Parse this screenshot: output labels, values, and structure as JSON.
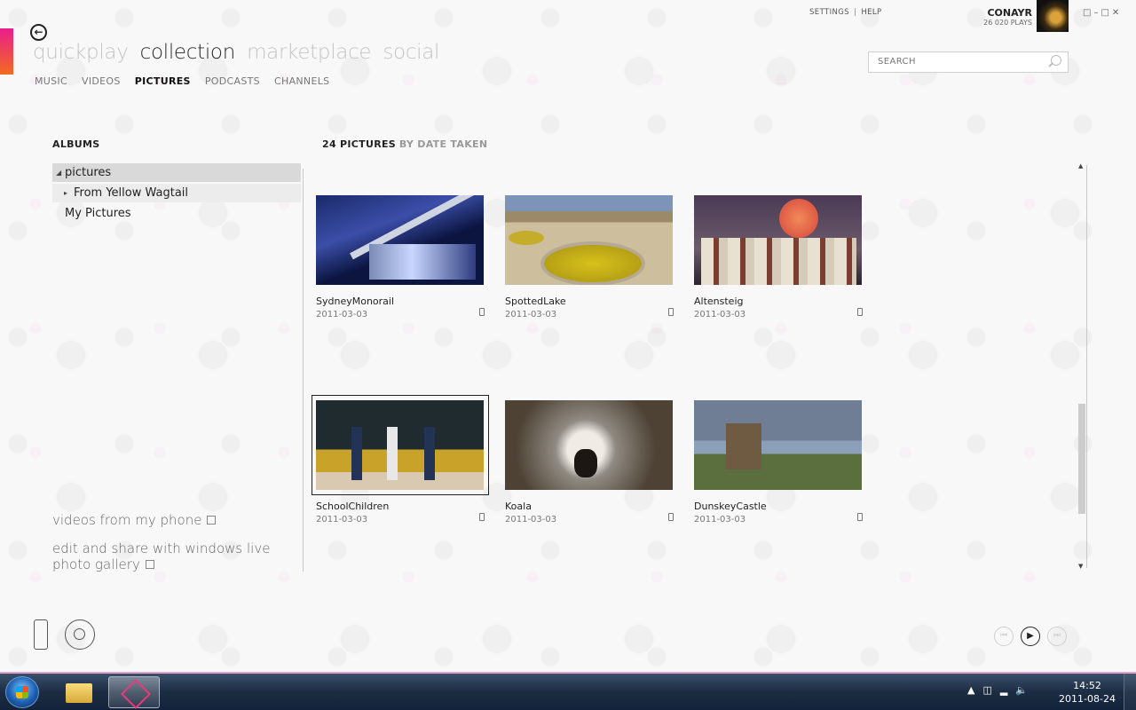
{
  "app": {
    "pivots": [
      {
        "label": "quickplay",
        "active": false
      },
      {
        "label": "collection",
        "active": true
      },
      {
        "label": "marketplace",
        "active": false
      },
      {
        "label": "social",
        "active": false
      }
    ],
    "subnav": [
      {
        "label": "MUSIC",
        "active": false
      },
      {
        "label": "VIDEOS",
        "active": false
      },
      {
        "label": "PICTURES",
        "active": true
      },
      {
        "label": "PODCASTS",
        "active": false
      },
      {
        "label": "CHANNELS",
        "active": false
      }
    ],
    "top_links": {
      "settings": "SETTINGS",
      "separator": "|",
      "help": "HELP"
    },
    "user": {
      "name": "CONAYR",
      "plays": "26 020 PLAYS"
    },
    "search": {
      "placeholder": "SEARCH"
    }
  },
  "sidebar": {
    "title": "ALBUMS",
    "tree": [
      {
        "label": "pictures",
        "expanded": true
      },
      {
        "label": "From Yellow Wagtail",
        "expanded": false
      },
      {
        "label": "My Pictures"
      }
    ],
    "links": [
      {
        "label": "videos from my phone"
      },
      {
        "label": "edit and share with windows live photo gallery"
      }
    ]
  },
  "grid": {
    "count": "24 PICTURES",
    "sort": "BY DATE TAKEN",
    "pictures": [
      {
        "title": "SydneyMonorail",
        "date": "2011-03-03"
      },
      {
        "title": "SpottedLake",
        "date": "2011-03-03"
      },
      {
        "title": "Altensteig",
        "date": "2011-03-03"
      },
      {
        "title": "SchoolChildren",
        "date": "2011-03-03"
      },
      {
        "title": "Koala",
        "date": "2011-03-03"
      },
      {
        "title": "DunskeyCastle",
        "date": "2011-03-03"
      }
    ]
  },
  "taskbar": {
    "time": "14:52",
    "date": "2011-08-24"
  },
  "colors": {
    "accent_top": "#e91e8c",
    "accent_bottom": "#f36a21"
  }
}
